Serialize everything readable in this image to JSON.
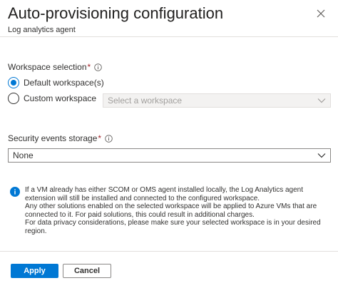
{
  "header": {
    "title": "Auto-provisioning configuration",
    "subtitle": "Log analytics agent"
  },
  "workspace": {
    "label": "Workspace selection",
    "required_mark": "*",
    "options": [
      {
        "label": "Default workspace(s)",
        "checked": true
      },
      {
        "label": "Custom workspace",
        "checked": false
      }
    ],
    "select_placeholder": "Select a workspace"
  },
  "security": {
    "label": "Security events storage",
    "required_mark": "*",
    "value": "None"
  },
  "info": {
    "lines": [
      "If a VM already has either SCOM or OMS agent installed locally, the Log Analytics agent extension will still be installed and connected to the configured workspace.",
      "Any other solutions enabled on the selected workspace will be applied to Azure VMs that are connected to it. For paid solutions, this could result in additional charges.",
      "For data privacy considerations, please make sure your selected workspace is in your desired region."
    ]
  },
  "footer": {
    "apply_label": "Apply",
    "cancel_label": "Cancel"
  },
  "colors": {
    "accent": "#0078d4",
    "required": "#a4262c",
    "text": "#323130",
    "divider": "#e1dfdd"
  },
  "icons": {
    "close": "close-icon",
    "info": "info-icon",
    "chevron": "chevron-down-icon"
  }
}
